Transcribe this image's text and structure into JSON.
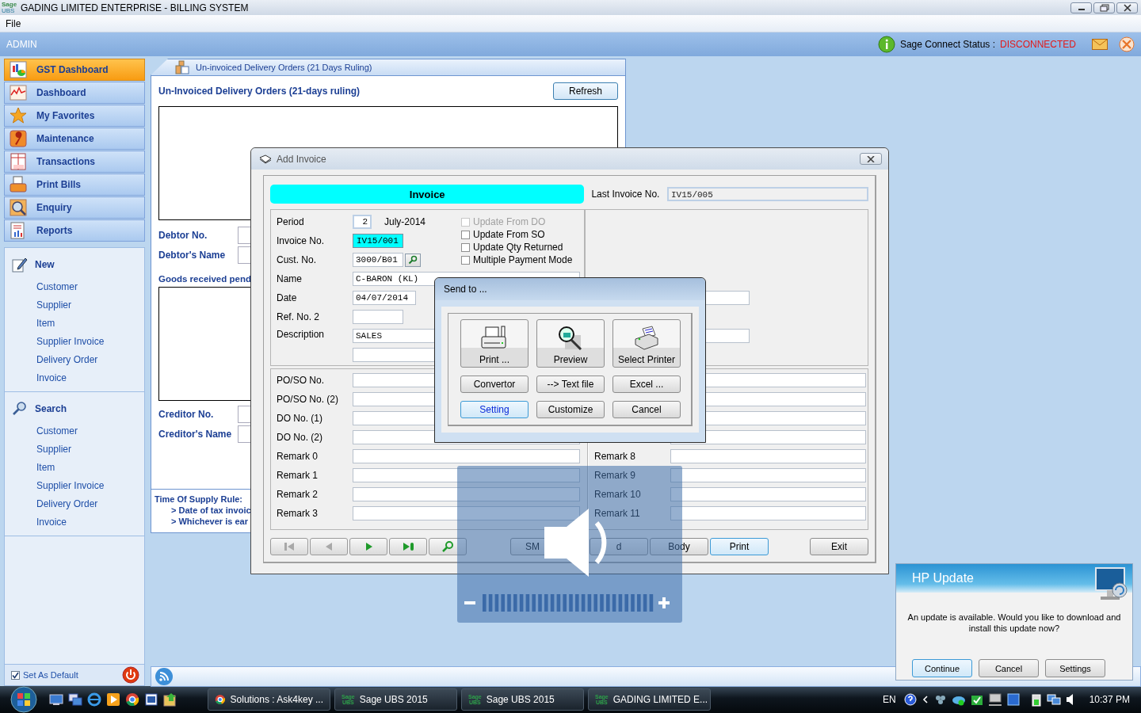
{
  "app_window": {
    "logo": [
      "Sage",
      "UBS"
    ],
    "title": "GADING LIMITED ENTERPRISE - BILLING SYSTEM"
  },
  "menu": [
    "File"
  ],
  "header": {
    "user": "ADMIN",
    "status_label": "Sage Connect Status :",
    "status_value": "DISCONNECTED"
  },
  "sidebar": {
    "items": [
      {
        "label": "GST Dashboard",
        "selected": true
      },
      {
        "label": "Dashboard",
        "selected": false
      },
      {
        "label": "My Favorites",
        "selected": false
      },
      {
        "label": "Maintenance",
        "selected": false
      },
      {
        "label": "Transactions",
        "selected": false
      },
      {
        "label": "Print Bills",
        "selected": false
      },
      {
        "label": "Enquiry",
        "selected": false
      },
      {
        "label": "Reports",
        "selected": false
      }
    ],
    "sections": [
      {
        "title": "New",
        "items": [
          "Customer",
          "Supplier",
          "Item",
          "Supplier Invoice",
          "Delivery Order",
          "Invoice"
        ]
      },
      {
        "title": "Search",
        "items": [
          "Customer",
          "Supplier",
          "Item",
          "Supplier Invoice",
          "Delivery Order",
          "Invoice"
        ]
      }
    ],
    "set_default": {
      "label": "Set As Default",
      "checked": true
    }
  },
  "background_panel": {
    "tab": "Un-invoiced Delivery Orders (21 Days Ruling)",
    "heading": "Un-Invoiced Delivery Orders (21-days ruling)",
    "refresh": "Refresh",
    "debtor_fields": [
      "Debtor No.",
      "Debtor's Name"
    ],
    "goods_heading": "Goods received pend",
    "creditor_fields": [
      "Creditor No.",
      "Creditor's Name"
    ],
    "rule_title": "Time Of Supply Rule:",
    "rules": [
      "> Date of tax invoic",
      "> Whichever is ear"
    ]
  },
  "invoice_dialog": {
    "title": "Add Invoice",
    "banner": "Invoice",
    "last_invoice_label": "Last Invoice No.",
    "last_invoice_value": "IV15/005",
    "fields": [
      {
        "label": "Period",
        "kind": "period",
        "value": "2",
        "note": "July-2014",
        "highlighted": false
      },
      {
        "label": "Invoice No.",
        "kind": "code",
        "value": "IV15/001",
        "highlighted": true
      },
      {
        "label": "Cust. No.",
        "kind": "lookup",
        "value": "3000/B01",
        "highlighted": false
      },
      {
        "label": "Name",
        "kind": "wide",
        "value": "C-BARON (KL)",
        "highlighted": false
      },
      {
        "label": "Date",
        "kind": "date",
        "value": "04/07/2014",
        "highlighted": false
      },
      {
        "label": "Ref. No. 2",
        "kind": "code",
        "highlighted": false
      },
      {
        "label": "Description",
        "kind": "multiline",
        "value": "SALES",
        "highlighted": false
      }
    ],
    "options": [
      {
        "label": "Update From DO",
        "checked": false,
        "disabled": true
      },
      {
        "label": "Update From SO",
        "checked": false,
        "disabled": false
      },
      {
        "label": "Update Qty Returned",
        "checked": false,
        "disabled": false
      },
      {
        "label": "Multiple Payment Mode",
        "checked": false,
        "disabled": false
      }
    ],
    "left_rows": [
      "PO/SO No.",
      "PO/SO No. (2)",
      "DO No. (1)",
      "DO No. (2)",
      "Remark 0",
      "Remark 1",
      "Remark 2",
      "Remark 3"
    ],
    "right_rows": [
      "Remark 8",
      "Remark 9",
      "Remark 10",
      "Remark 11"
    ],
    "nav_buttons": [
      {
        "kind": "first",
        "disabled": true
      },
      {
        "kind": "prev",
        "disabled": true
      },
      {
        "kind": "next",
        "disabled": false
      },
      {
        "kind": "last",
        "disabled": false
      },
      {
        "kind": "find",
        "disabled": false
      }
    ],
    "buttons": [
      {
        "label": "SM",
        "focused": false
      },
      {
        "label": "d",
        "focused": false
      },
      {
        "label": "Body",
        "focused": false
      },
      {
        "label": "Print",
        "focused": true
      },
      {
        "label": "Exit",
        "focused": false
      }
    ]
  },
  "send_to_dialog": {
    "title": "Send to ...",
    "big_buttons": [
      {
        "label": "Print ...",
        "kind": "printer"
      },
      {
        "label": "Preview",
        "kind": "preview"
      },
      {
        "label": "Select Printer",
        "kind": "select"
      }
    ],
    "buttons": [
      {
        "label": "Convertor",
        "focused": false
      },
      {
        "label": "--> Text file",
        "focused": false
      },
      {
        "label": "Excel ...",
        "focused": false
      },
      {
        "label": "Setting",
        "focused": true
      },
      {
        "label": "Customize",
        "focused": false
      },
      {
        "label": "Cancel",
        "focused": false
      }
    ]
  },
  "hp_update": {
    "title": "HP Update",
    "message": "An update is available. Would you like to download and install this update now?",
    "buttons": [
      {
        "label": "Continue",
        "focused": true
      },
      {
        "label": "Cancel",
        "focused": false
      },
      {
        "label": "Settings",
        "focused": false
      }
    ]
  },
  "taskbar": {
    "tasks": [
      {
        "label": "Solutions : Ask4key ...",
        "kind": "browser"
      },
      {
        "label": "Sage UBS 2015",
        "kind": "sage",
        "logo": [
          "Sage",
          "UBS"
        ]
      },
      {
        "label": "Sage UBS 2015",
        "kind": "sage",
        "logo": [
          "Sage",
          "UBS"
        ]
      },
      {
        "label": "GADING LIMITED E...",
        "kind": "sage",
        "logo": [
          "Sage",
          "UBS"
        ]
      }
    ],
    "language": "EN",
    "clock": "10:37 PM"
  }
}
